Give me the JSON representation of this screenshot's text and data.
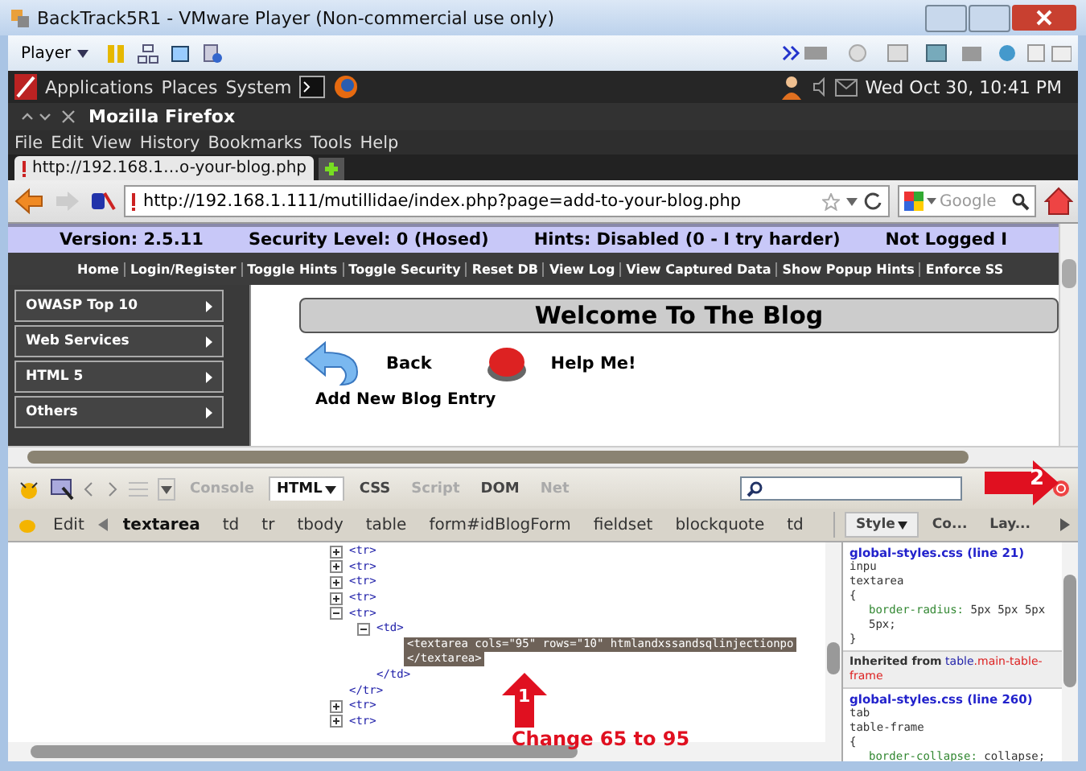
{
  "vm_window": {
    "title": "BackTrack5R1 - VMware Player (Non-commercial use only)"
  },
  "vm_toolbar": {
    "player_menu": "Player"
  },
  "gnome_panel": {
    "menus": [
      "Applications",
      "Places",
      "System"
    ],
    "clock": "Wed Oct 30, 10:41 PM"
  },
  "firefox": {
    "title": "Mozilla Firefox",
    "menus": [
      "File",
      "Edit",
      "View",
      "History",
      "Bookmarks",
      "Tools",
      "Help"
    ],
    "tabs": [
      {
        "label": "http://192.168.1…o-your-blog.php",
        "selected": true
      }
    ],
    "url": "http://192.168.1.111/mutillidae/index.php?page=add-to-your-blog.php",
    "search_placeholder": "Google"
  },
  "page": {
    "status": [
      "Version: 2.5.11",
      "Security Level: 0 (Hosed)",
      "Hints: Disabled (0 - I try harder)",
      "Not Logged I"
    ],
    "nav": [
      "Home",
      "Login/Register",
      "Toggle Hints",
      "Toggle Security",
      "Reset DB",
      "View Log",
      "View Captured Data",
      "Show Popup Hints",
      "Enforce SS"
    ],
    "sidebar": [
      "OWASP Top 10",
      "Web Services",
      "HTML 5",
      "Others"
    ],
    "heading": "Welcome To The Blog",
    "back": "Back",
    "help": "Help Me!",
    "subheading": "Add New Blog Entry"
  },
  "firebug": {
    "panel_tabs": [
      {
        "label": "Console",
        "selected": false,
        "disabled": true
      },
      {
        "label": "HTML",
        "selected": true,
        "disabled": false
      },
      {
        "label": "CSS",
        "selected": false,
        "disabled": false
      },
      {
        "label": "Script",
        "selected": false,
        "disabled": true
      },
      {
        "label": "DOM",
        "selected": false,
        "disabled": false
      },
      {
        "label": "Net",
        "selected": false,
        "disabled": true
      }
    ],
    "edit": "Edit",
    "breadcrumbs": [
      {
        "label": "textarea",
        "selected": true
      },
      {
        "label": "td",
        "selected": false
      },
      {
        "label": "tr",
        "selected": false
      },
      {
        "label": "tbody",
        "selected": false
      },
      {
        "label": "table",
        "selected": false
      },
      {
        "label": "form#idBlogForm",
        "selected": false
      },
      {
        "label": "fieldset",
        "selected": false
      },
      {
        "label": "blockquote",
        "selected": false
      },
      {
        "label": "td",
        "selected": false
      }
    ],
    "tree": [
      {
        "tag": "<tr>",
        "expanded": false,
        "selected": false
      },
      {
        "tag": "<tr>",
        "expanded": false,
        "selected": false
      },
      {
        "tag": "<tr>",
        "expanded": false,
        "selected": false
      },
      {
        "tag": "<tr>",
        "expanded": false,
        "selected": false
      },
      {
        "tag": "<tr>",
        "close": "</tr>",
        "expanded": true,
        "selected": false,
        "children": [
          {
            "tag": "<td>",
            "close": "</td>",
            "expanded": true,
            "selected": false,
            "children": [
              {
                "tag": "<textarea cols=\"95\" rows=\"10\" htmlandxssandsqlinjectionpo",
                "close": "</textarea>",
                "selected": true
              }
            ]
          }
        ]
      },
      {
        "tag": "<tr>",
        "expanded": false,
        "selected": false
      },
      {
        "tag": "<tr>",
        "expanded": false,
        "selected": false
      }
    ],
    "side_tabs": [
      {
        "label": "Style",
        "selected": true
      },
      {
        "label": "Co...",
        "selected": false
      },
      {
        "label": "Lay...",
        "selected": false
      }
    ],
    "styles": [
      {
        "kind": "rule",
        "link": "global-styles.css (line 21)",
        "selector_lines": [
          "inpu",
          "textarea"
        ],
        "open": "{",
        "declarations": [
          {
            "property": "border-radius:",
            "value": "5px 5px 5px 5px;"
          }
        ],
        "close": "}"
      },
      {
        "kind": "inherited",
        "label": "Inherited from",
        "element": "table",
        "class": ".main-table-frame"
      },
      {
        "kind": "rule",
        "link": "global-styles.css (line 260)",
        "selector_lines": [
          "tab",
          "table-frame"
        ],
        "open": "{",
        "declarations": [
          {
            "property": "border-collapse:",
            "value": "collapse;"
          }
        ]
      }
    ]
  },
  "annotations": [
    {
      "number": "1",
      "text": "Change 65 to 95"
    },
    {
      "number": "2"
    }
  ]
}
